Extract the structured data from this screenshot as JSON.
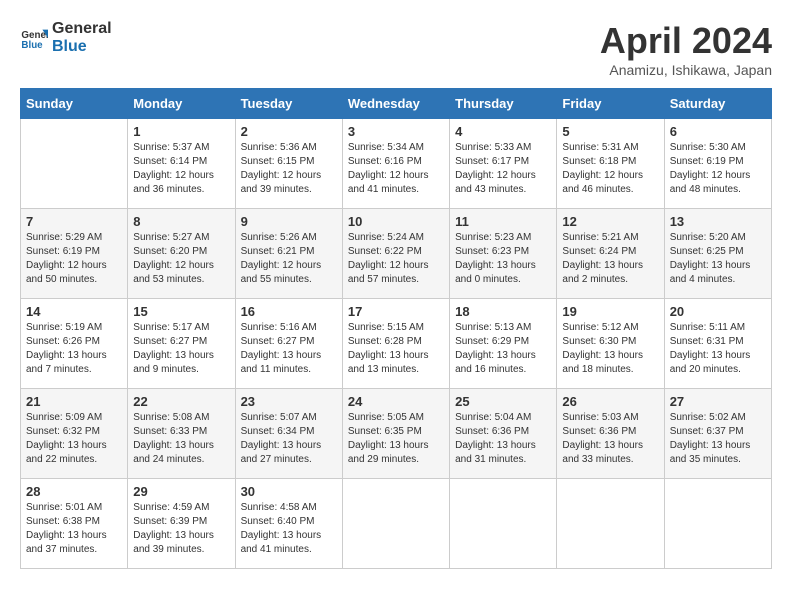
{
  "header": {
    "logo_general": "General",
    "logo_blue": "Blue",
    "title": "April 2024",
    "location": "Anamizu, Ishikawa, Japan"
  },
  "weekdays": [
    "Sunday",
    "Monday",
    "Tuesday",
    "Wednesday",
    "Thursday",
    "Friday",
    "Saturday"
  ],
  "weeks": [
    [
      {
        "day": "",
        "info": ""
      },
      {
        "day": "1",
        "info": "Sunrise: 5:37 AM\nSunset: 6:14 PM\nDaylight: 12 hours\nand 36 minutes."
      },
      {
        "day": "2",
        "info": "Sunrise: 5:36 AM\nSunset: 6:15 PM\nDaylight: 12 hours\nand 39 minutes."
      },
      {
        "day": "3",
        "info": "Sunrise: 5:34 AM\nSunset: 6:16 PM\nDaylight: 12 hours\nand 41 minutes."
      },
      {
        "day": "4",
        "info": "Sunrise: 5:33 AM\nSunset: 6:17 PM\nDaylight: 12 hours\nand 43 minutes."
      },
      {
        "day": "5",
        "info": "Sunrise: 5:31 AM\nSunset: 6:18 PM\nDaylight: 12 hours\nand 46 minutes."
      },
      {
        "day": "6",
        "info": "Sunrise: 5:30 AM\nSunset: 6:19 PM\nDaylight: 12 hours\nand 48 minutes."
      }
    ],
    [
      {
        "day": "7",
        "info": "Sunrise: 5:29 AM\nSunset: 6:19 PM\nDaylight: 12 hours\nand 50 minutes."
      },
      {
        "day": "8",
        "info": "Sunrise: 5:27 AM\nSunset: 6:20 PM\nDaylight: 12 hours\nand 53 minutes."
      },
      {
        "day": "9",
        "info": "Sunrise: 5:26 AM\nSunset: 6:21 PM\nDaylight: 12 hours\nand 55 minutes."
      },
      {
        "day": "10",
        "info": "Sunrise: 5:24 AM\nSunset: 6:22 PM\nDaylight: 12 hours\nand 57 minutes."
      },
      {
        "day": "11",
        "info": "Sunrise: 5:23 AM\nSunset: 6:23 PM\nDaylight: 13 hours\nand 0 minutes."
      },
      {
        "day": "12",
        "info": "Sunrise: 5:21 AM\nSunset: 6:24 PM\nDaylight: 13 hours\nand 2 minutes."
      },
      {
        "day": "13",
        "info": "Sunrise: 5:20 AM\nSunset: 6:25 PM\nDaylight: 13 hours\nand 4 minutes."
      }
    ],
    [
      {
        "day": "14",
        "info": "Sunrise: 5:19 AM\nSunset: 6:26 PM\nDaylight: 13 hours\nand 7 minutes."
      },
      {
        "day": "15",
        "info": "Sunrise: 5:17 AM\nSunset: 6:27 PM\nDaylight: 13 hours\nand 9 minutes."
      },
      {
        "day": "16",
        "info": "Sunrise: 5:16 AM\nSunset: 6:27 PM\nDaylight: 13 hours\nand 11 minutes."
      },
      {
        "day": "17",
        "info": "Sunrise: 5:15 AM\nSunset: 6:28 PM\nDaylight: 13 hours\nand 13 minutes."
      },
      {
        "day": "18",
        "info": "Sunrise: 5:13 AM\nSunset: 6:29 PM\nDaylight: 13 hours\nand 16 minutes."
      },
      {
        "day": "19",
        "info": "Sunrise: 5:12 AM\nSunset: 6:30 PM\nDaylight: 13 hours\nand 18 minutes."
      },
      {
        "day": "20",
        "info": "Sunrise: 5:11 AM\nSunset: 6:31 PM\nDaylight: 13 hours\nand 20 minutes."
      }
    ],
    [
      {
        "day": "21",
        "info": "Sunrise: 5:09 AM\nSunset: 6:32 PM\nDaylight: 13 hours\nand 22 minutes."
      },
      {
        "day": "22",
        "info": "Sunrise: 5:08 AM\nSunset: 6:33 PM\nDaylight: 13 hours\nand 24 minutes."
      },
      {
        "day": "23",
        "info": "Sunrise: 5:07 AM\nSunset: 6:34 PM\nDaylight: 13 hours\nand 27 minutes."
      },
      {
        "day": "24",
        "info": "Sunrise: 5:05 AM\nSunset: 6:35 PM\nDaylight: 13 hours\nand 29 minutes."
      },
      {
        "day": "25",
        "info": "Sunrise: 5:04 AM\nSunset: 6:36 PM\nDaylight: 13 hours\nand 31 minutes."
      },
      {
        "day": "26",
        "info": "Sunrise: 5:03 AM\nSunset: 6:36 PM\nDaylight: 13 hours\nand 33 minutes."
      },
      {
        "day": "27",
        "info": "Sunrise: 5:02 AM\nSunset: 6:37 PM\nDaylight: 13 hours\nand 35 minutes."
      }
    ],
    [
      {
        "day": "28",
        "info": "Sunrise: 5:01 AM\nSunset: 6:38 PM\nDaylight: 13 hours\nand 37 minutes."
      },
      {
        "day": "29",
        "info": "Sunrise: 4:59 AM\nSunset: 6:39 PM\nDaylight: 13 hours\nand 39 minutes."
      },
      {
        "day": "30",
        "info": "Sunrise: 4:58 AM\nSunset: 6:40 PM\nDaylight: 13 hours\nand 41 minutes."
      },
      {
        "day": "",
        "info": ""
      },
      {
        "day": "",
        "info": ""
      },
      {
        "day": "",
        "info": ""
      },
      {
        "day": "",
        "info": ""
      }
    ]
  ]
}
